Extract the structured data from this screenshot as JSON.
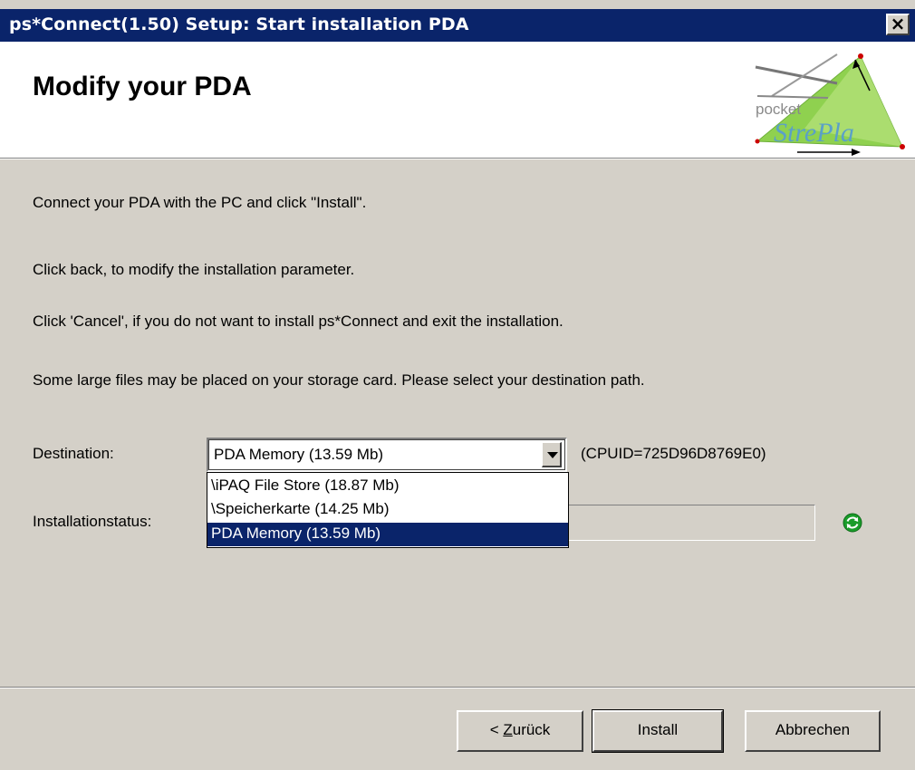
{
  "window": {
    "title": "ps*Connect(1.50) Setup: Start installation PDA",
    "close_label": "×"
  },
  "header": {
    "title": "Modify your PDA",
    "logo_top": "pocket",
    "logo_bottom": "StrePla"
  },
  "body": {
    "line1": "Connect your PDA with the PC and click \"Install\".",
    "line2": "Click back, to modify the installation parameter.",
    "line3": "Click  'Cancel', if you do not want to install ps*Connect and exit the installation.",
    "line4": "Some large files may  be placed on your storage card. Please select your destination path."
  },
  "destination": {
    "label": "Destination:",
    "selected": "PDA Memory (13.59 Mb)",
    "cpuid": "(CPUID=725D96D8769E0)",
    "options": [
      "\\iPAQ File Store (18.87 Mb)",
      "\\Speicherkarte (14.25 Mb)",
      "PDA Memory (13.59 Mb)"
    ]
  },
  "status": {
    "label": "Installationstatus:",
    "icon": "refresh-icon"
  },
  "buttons": {
    "back_prefix": "< ",
    "back_mnemonic": "Z",
    "back_rest": "urück",
    "install": "Install",
    "cancel": "Abbrechen"
  },
  "colors": {
    "titlebar": "#0a246a",
    "dialog_bg": "#d4d0c8",
    "selection": "#0a246a",
    "icon_green": "#1a9c2a"
  }
}
